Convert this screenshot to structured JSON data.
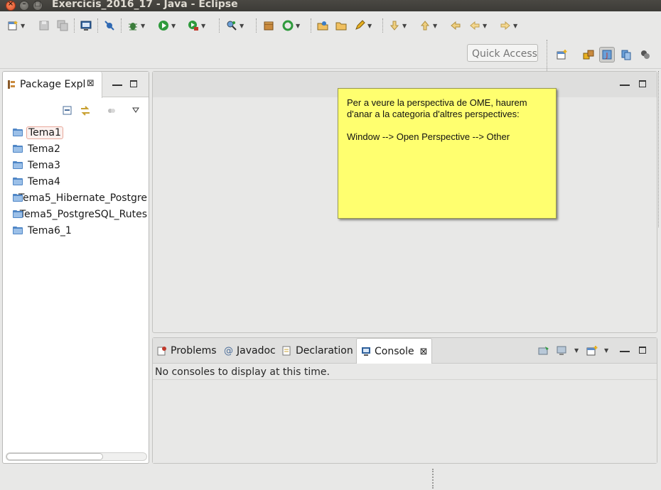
{
  "window": {
    "title": "Exercicis_2016_17 - Java - Eclipse",
    "close_glyph": "×",
    "minimize_glyph": "–",
    "maximize_glyph": "□"
  },
  "toolbar": {
    "quick_access_placeholder": "Quick Access",
    "icons": [
      "new-icon",
      "save-icon",
      "save-all-icon",
      "terminal-icon",
      "skip-breakpoints-icon",
      "debug-icon",
      "run-icon",
      "run-external-icon",
      "search-icon",
      "new-package-icon",
      "refresh-icon",
      "open-type-icon",
      "open-folder-icon",
      "pen-icon",
      "next-annotation-icon",
      "previous-annotation-icon",
      "last-edit-icon",
      "back-icon",
      "forward-icon"
    ]
  },
  "perspectives": {
    "items": [
      "open-perspective-icon",
      "java-ee-perspective-icon",
      "java-perspective-icon",
      "debug-perspective-icon",
      "team-perspective-icon"
    ],
    "active_index": 2
  },
  "package_explorer": {
    "tab_label": "Package Expl",
    "close_glyph": "⊠",
    "items": [
      {
        "label": "Tema1",
        "selected": true
      },
      {
        "label": "Tema2",
        "selected": false
      },
      {
        "label": "Tema3",
        "selected": false
      },
      {
        "label": "Tema4",
        "selected": false
      },
      {
        "label": "Tema5_Hibernate_Postgre",
        "selected": false
      },
      {
        "label": "Tema5_PostgreSQL_Rutes",
        "selected": false
      },
      {
        "label": "Tema6_1",
        "selected": false
      }
    ]
  },
  "note": {
    "line1": "Per a veure la perspectiva de OME, haurem d'anar a la categoria d'altres perspectives:",
    "line2": "Window --> Open Perspective --> Other",
    "color": "#ffff6f"
  },
  "bottom_panel": {
    "tabs": [
      {
        "label": "Problems",
        "icon": "problems-icon"
      },
      {
        "label": "Javadoc",
        "icon": "javadoc-icon"
      },
      {
        "label": "Declaration",
        "icon": "declaration-icon"
      },
      {
        "label": "Console",
        "icon": "console-icon",
        "active": true
      }
    ],
    "close_glyph": "⊠",
    "console_message": "No consoles to display at this time."
  }
}
